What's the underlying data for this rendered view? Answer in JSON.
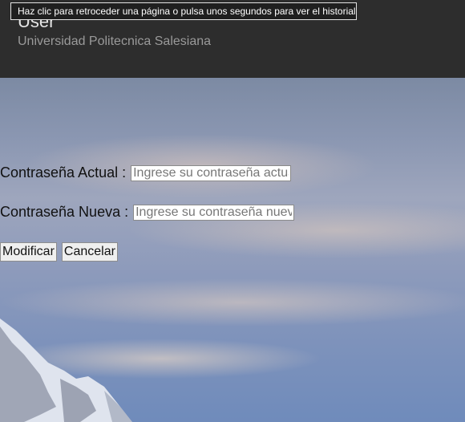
{
  "header": {
    "title": "User",
    "subtitle": "Universidad Politecnica Salesiana"
  },
  "tooltip": {
    "text": "Haz clic para retroceder una página o pulsa unos segundos para ver el historial"
  },
  "form": {
    "current_password": {
      "label": "Contraseña Actual :",
      "placeholder": "Ingrese su contraseña actual"
    },
    "new_password": {
      "label": "Contraseña Nueva :",
      "placeholder": "Ingrese su contraseña nueva"
    },
    "submit_label": "Modificar",
    "cancel_label": "Cancelar"
  }
}
